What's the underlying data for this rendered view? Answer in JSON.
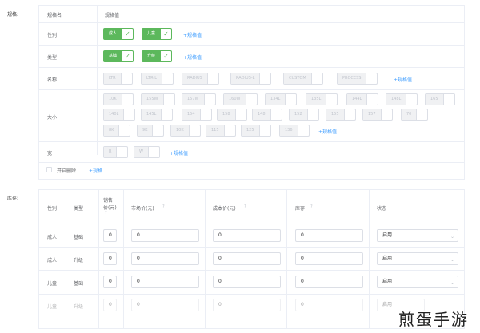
{
  "spec": {
    "section_label": "规格:",
    "header": {
      "name_col": "规格名",
      "value_col": "规格值"
    },
    "rows": [
      {
        "name": "性别",
        "values": [
          "成人",
          "儿童"
        ],
        "add": "+规格值"
      },
      {
        "name": "类型",
        "values": [
          "基础",
          "升级"
        ],
        "add": "+规格值"
      },
      {
        "name": "名称",
        "values": [
          "LTR",
          "LTR-L",
          "RADIUS",
          "RADIUS-L",
          "CUSTOM",
          "PROCESS"
        ],
        "add": "+规格值"
      },
      {
        "name": "大小",
        "values": [
          "10K",
          "155W",
          "157W",
          "160W",
          "134L",
          "135L",
          "144L",
          "148L",
          "165",
          "140L",
          "145L",
          "154",
          "158",
          "148",
          "152",
          "155",
          "157",
          "70",
          "8K",
          "9K",
          "10K",
          "115",
          "125",
          "136"
        ],
        "add": "+规格值"
      },
      {
        "name": "宽",
        "values": [
          "R",
          "W"
        ],
        "add": "+规格值"
      }
    ],
    "footer": {
      "checkbox_label": "开启删除",
      "add_spec": "+规格"
    }
  },
  "inventory": {
    "section_label": "库存:",
    "headers": {
      "gender": "性别",
      "type": "类型",
      "sale_price": [
        "销售",
        "价(元)"
      ],
      "market_price": "市场价(元)",
      "cost_price": "成本价(元)",
      "stock": "库存",
      "status": "状态"
    },
    "rows": [
      {
        "gender": "成人",
        "type": "基础",
        "sale": "0",
        "market": "0",
        "cost": "0",
        "stock": "0",
        "status": "启用"
      },
      {
        "gender": "成人",
        "type": "升级",
        "sale": "0",
        "market": "0",
        "cost": "0",
        "stock": "0",
        "status": "启用"
      },
      {
        "gender": "儿童",
        "type": "基础",
        "sale": "0",
        "market": "0",
        "cost": "0",
        "stock": "0",
        "status": "启用"
      },
      {
        "gender": "儿童",
        "type": "升级",
        "sale": "0",
        "market": "0",
        "cost": "0",
        "stock": "0",
        "status": "启用"
      }
    ]
  },
  "watermark": "煎蛋手游",
  "icons": {
    "check": "check-icon",
    "help": "help-icon",
    "arrow": "chevron-down-icon"
  },
  "colors": {
    "accent": "#5cb85c",
    "link": "#409eff",
    "border": "#ebeef5"
  }
}
